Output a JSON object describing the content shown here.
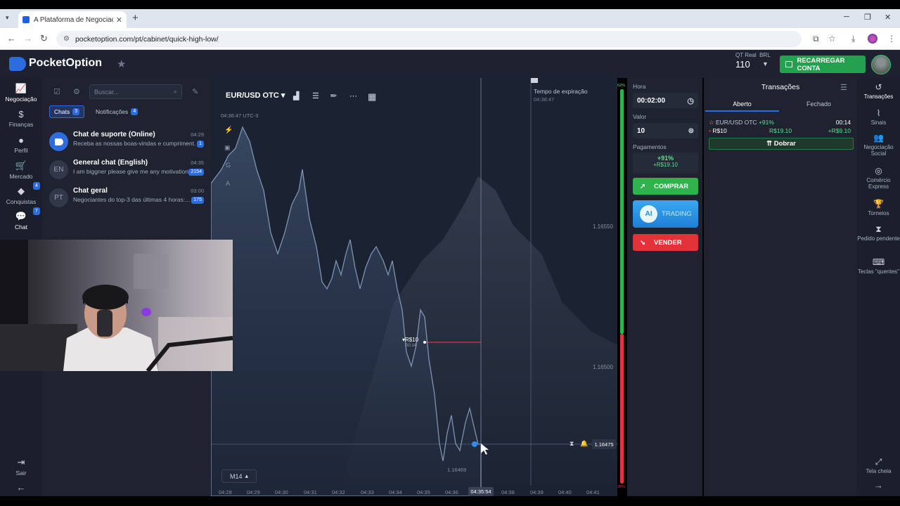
{
  "browser": {
    "tab_title": "A Plataforma de Negociação M",
    "url": "pocketoption.com/pt/cabinet/quick-high-low/"
  },
  "header": {
    "logo": "PocketOption",
    "account_type": "QT Real",
    "currency": "BRL",
    "balance": "110",
    "reload_button": "RECARREGAR CONTA"
  },
  "left_nav": [
    {
      "label": "Negociação",
      "icon": "chart-line-icon"
    },
    {
      "label": "Finanças",
      "icon": "dollar-icon"
    },
    {
      "label": "Perfil",
      "icon": "user-icon"
    },
    {
      "label": "Mercado",
      "icon": "cart-icon"
    },
    {
      "label": "Conquistas",
      "icon": "diamond-icon",
      "badge": "4"
    },
    {
      "label": "Chat",
      "icon": "chat-icon",
      "badge": "7"
    }
  ],
  "left_nav_bottom": {
    "logout": "Sair"
  },
  "chat": {
    "search_placeholder": "Buscar...",
    "tabs": [
      {
        "label": "Chats",
        "count": "3"
      },
      {
        "label": "Notificações",
        "count": "4"
      }
    ],
    "items": [
      {
        "initials": "",
        "name": "Chat de suporte (Online)",
        "message": "Receba as nossas boas-vindas e cumpriment...",
        "time": "04:29",
        "count": "1"
      },
      {
        "initials": "EN",
        "name": "General chat (English)",
        "message": "I am biggner please give me any motivation",
        "time": "04:35",
        "count": "2154"
      },
      {
        "initials": "PT",
        "name": "Chat geral",
        "message": "Negociantes do top-3 das últimas 4 horas:...",
        "time": "03:00",
        "count": "175"
      }
    ]
  },
  "chart": {
    "pair": "EUR/USD OTC",
    "timestamp": "04:36:47 UTC-3",
    "timeframe": "M14",
    "current_price": "1.16475",
    "low_price": "1.16469",
    "price_labels": [
      "1.16550",
      "1.16500"
    ],
    "time_labels": [
      "04:28",
      "04:29",
      "04:30",
      "04:31",
      "04:32",
      "04:33",
      "04:34",
      "04:35",
      "04:36",
      "04:38",
      "04:39",
      "04:40",
      "04:41"
    ],
    "current_time": "04:35:54",
    "expiry_label": "Tempo de expiração",
    "expiry_time": "04:38:47",
    "trade_marker": "R$10",
    "trade_marker_sub": "00:14",
    "left_tools": [
      "G",
      "A"
    ]
  },
  "trade": {
    "time_label": "Hora",
    "time_value": "00:02:00",
    "amount_label": "Valor",
    "amount_value": "10",
    "payout_label": "Pagamentos",
    "payout_percent": "+91%",
    "payout_value": "+R$19.10",
    "buy_label": "COMPRAR",
    "ai_label": "TRADING",
    "ai_badge": "AI",
    "sell_label": "VENDER",
    "bar_top": "62%",
    "bar_bottom": "38%"
  },
  "transactions": {
    "title": "Transações",
    "tabs": [
      "Aberto",
      "Fechado"
    ],
    "items": [
      {
        "pair": "EUR/USD OTC",
        "percent": "+91%",
        "time": "00:14",
        "amount": "R$10",
        "payout": "R$19.10",
        "profit": "+R$9.10"
      }
    ],
    "double_button": "Dobrar"
  },
  "right_nav": [
    {
      "label": "Transações",
      "icon": "history-icon"
    },
    {
      "label": "Sinais",
      "icon": "signal-icon"
    },
    {
      "label": "Negociação Social",
      "icon": "users-icon"
    },
    {
      "label": "Comércio Express",
      "icon": "target-icon"
    },
    {
      "label": "Torneios",
      "icon": "trophy-icon"
    },
    {
      "label": "Pedido pendente",
      "icon": "hourglass-icon"
    },
    {
      "label": "Teclas \"quentes\"",
      "icon": "keyboard-icon"
    }
  ],
  "right_nav_bottom": {
    "fullscreen": "Tela cheia"
  },
  "colors": {
    "buy": "#2eb34d",
    "sell": "#e3323a",
    "accent": "#2d6cdf",
    "ai": "#39a8f0"
  }
}
